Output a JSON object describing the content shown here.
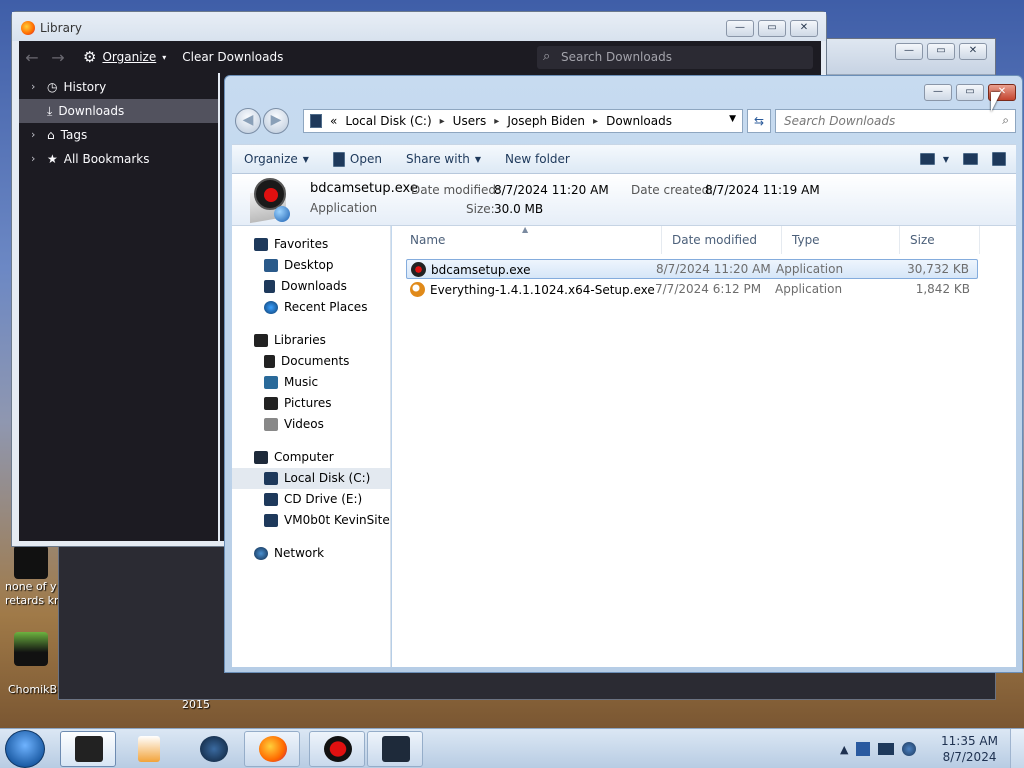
{
  "desktop": {
    "text_left1": "none of y",
    "text_left2": "retards kn",
    "text_left3": "ChomikB",
    "year": "2015"
  },
  "library": {
    "title": "Library",
    "organize_label": "Organize",
    "clear_label": "Clear Downloads",
    "search_placeholder": "Search Downloads",
    "sidebar": [
      {
        "label": "History"
      },
      {
        "label": "Downloads"
      },
      {
        "label": "Tags"
      },
      {
        "label": "All Bookmarks"
      }
    ]
  },
  "explorer": {
    "address": {
      "chevron": "«",
      "segments": [
        "Local Disk (C:)",
        "Users",
        "Joseph Biden",
        "Downloads"
      ]
    },
    "search_placeholder": "Search Downloads",
    "commands": {
      "organize": "Organize",
      "open": "Open",
      "share_with": "Share with",
      "new_folder": "New folder"
    },
    "details": {
      "name": "bdcamsetup.exe",
      "type": "Application",
      "modified_label": "Date modified:",
      "modified_value": "8/7/2024 11:20 AM",
      "created_label": "Date created:",
      "created_value": "8/7/2024 11:19 AM",
      "size_label": "Size:",
      "size_value": "30.0 MB"
    },
    "nav": {
      "favorites": "Favorites",
      "desktop": "Desktop",
      "downloads": "Downloads",
      "recent": "Recent Places",
      "libraries": "Libraries",
      "documents": "Documents",
      "music": "Music",
      "pictures": "Pictures",
      "videos": "Videos",
      "computer": "Computer",
      "local_disk": "Local Disk (C:)",
      "cd_drive": "CD Drive (E:)",
      "vm": "VM0b0t KevinSite",
      "network": "Network"
    },
    "columns": {
      "name": "Name",
      "date": "Date modified",
      "type": "Type",
      "size": "Size"
    },
    "files": [
      {
        "name": "bdcamsetup.exe",
        "date": "8/7/2024 11:20 AM",
        "type": "Application",
        "size": "30,732 KB"
      },
      {
        "name": "Everything-1.4.1.1024.x64-Setup.exe",
        "date": "7/7/2024 6:12 PM",
        "type": "Application",
        "size": "1,842 KB"
      }
    ]
  },
  "taskbar": {
    "time": "11:35 AM",
    "date": "8/7/2024"
  }
}
